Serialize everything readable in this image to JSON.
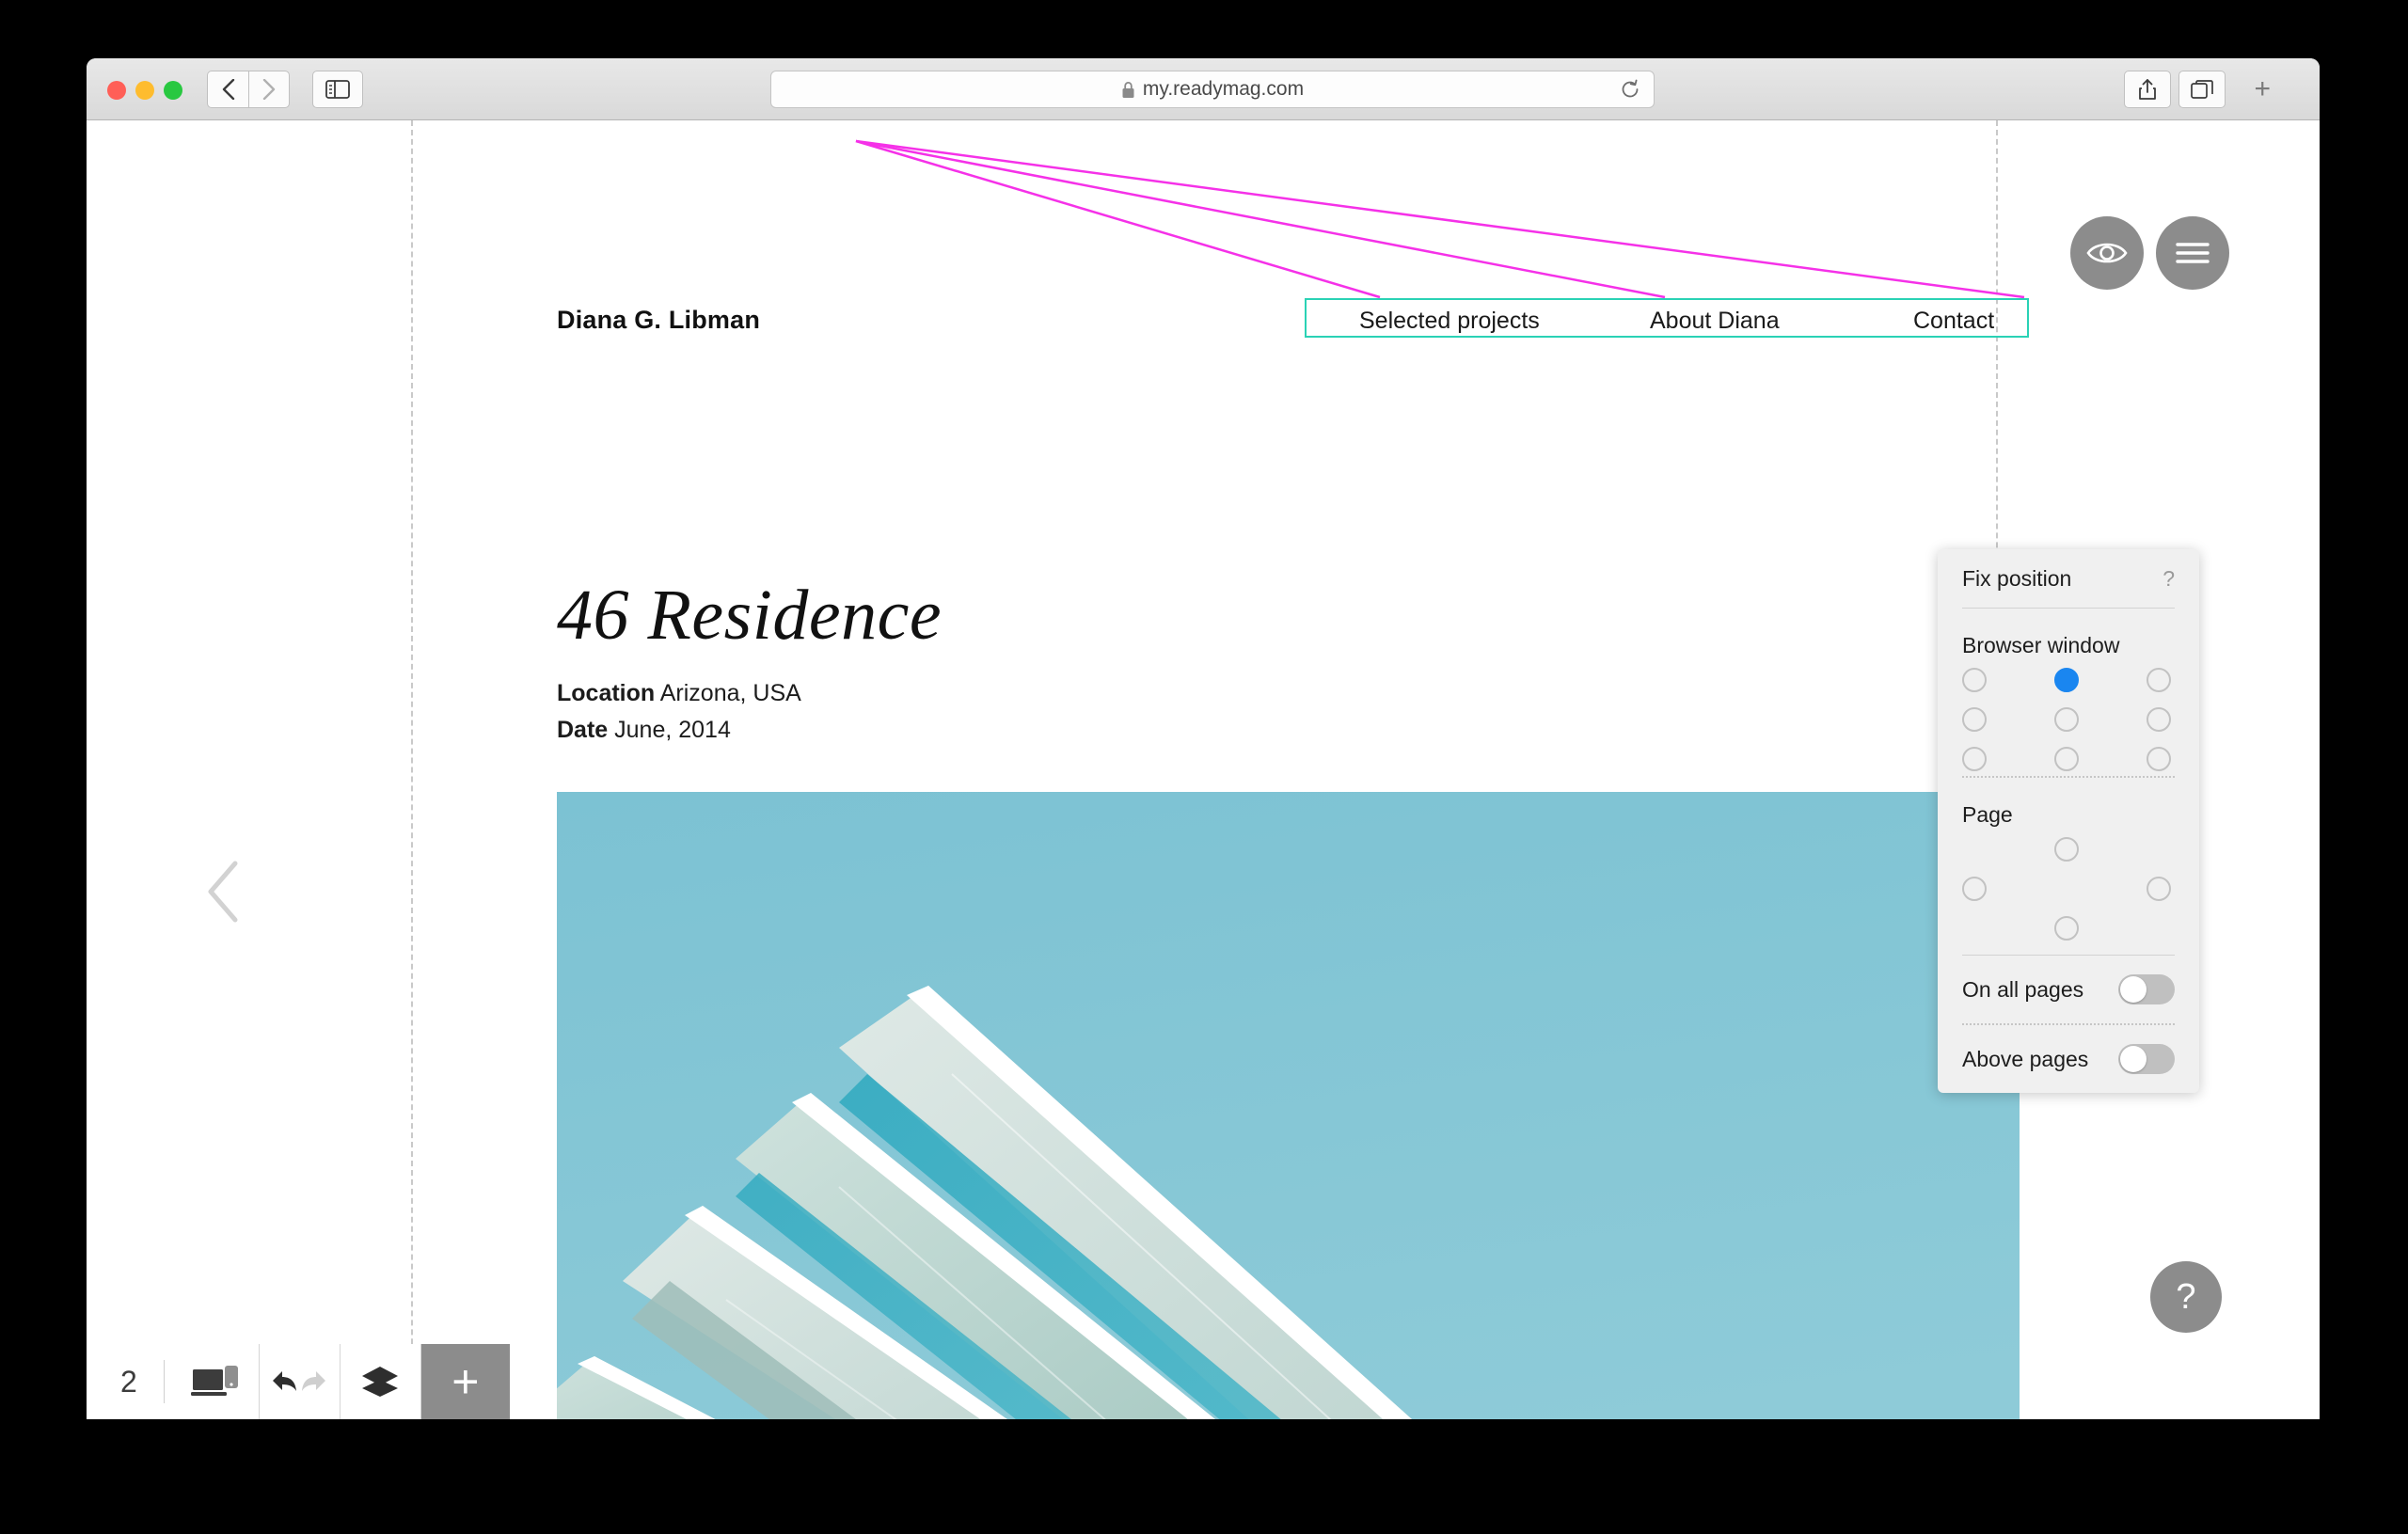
{
  "browser": {
    "url": "my.readymag.com",
    "lock_icon": "lock-icon",
    "reload_icon": "reload-icon",
    "back_icon": "chevron-left-icon",
    "forward_icon": "chevron-right-icon",
    "sidebar_icon": "sidebar-toggle-icon",
    "share_icon": "share-icon",
    "tabs_icon": "tab-overview-icon",
    "new_tab_label": "+"
  },
  "site": {
    "title": "Diana G. Libman",
    "nav": [
      {
        "label": "Selected projects"
      },
      {
        "label": "About Diana"
      },
      {
        "label": "Contact"
      }
    ],
    "project": {
      "heading": "46 Residence",
      "location_key": "Location",
      "location_value": " Arizona, USA",
      "date_key": "Date",
      "date_value": " June, 2014"
    }
  },
  "editor": {
    "preview_icon": "eye-icon",
    "menu_icon": "hamburger-menu-icon",
    "help_label": "?",
    "prev_page_icon": "chevron-left-icon",
    "next_page_icon": "chevron-right-icon",
    "selection_color": "#2ad2b5",
    "guide_color": "#ff2fe0",
    "tools": [
      {
        "name": "transform-tool",
        "icon": "resize-frame-icon",
        "active": false
      },
      {
        "name": "opacity-tool",
        "icon": "blend-circles-icon",
        "active": false
      },
      {
        "name": "align-tool",
        "icon": "align-icon",
        "active": false
      },
      {
        "name": "pin-tool",
        "icon": "pin-icon",
        "active": true
      },
      {
        "name": "layers-tool",
        "icon": "layers-icon",
        "active": false
      },
      {
        "name": "lock-tool",
        "icon": "lock-icon",
        "active": false
      }
    ],
    "bottom_bar": {
      "page_count": "2",
      "device_icon": "desktop-mobile-icon",
      "undo_icon": "undo-arrow-icon",
      "redo_icon": "redo-arrow-icon",
      "layers_icon": "layers-stack-icon",
      "add_label": "+"
    }
  },
  "fix_position_panel": {
    "title": "Fix position",
    "help_label": "?",
    "browser_section_label": "Browser window",
    "browser_anchors": [
      {
        "id": "top-left",
        "selected": false
      },
      {
        "id": "top-center",
        "selected": true
      },
      {
        "id": "top-right",
        "selected": false
      },
      {
        "id": "middle-left",
        "selected": false
      },
      {
        "id": "middle-center",
        "selected": false
      },
      {
        "id": "middle-right",
        "selected": false
      },
      {
        "id": "bottom-left",
        "selected": false
      },
      {
        "id": "bottom-center",
        "selected": false
      },
      {
        "id": "bottom-right",
        "selected": false
      }
    ],
    "page_section_label": "Page",
    "page_anchors": [
      {
        "id": "top",
        "selected": false
      },
      {
        "id": "left",
        "selected": false
      },
      {
        "id": "right",
        "selected": false
      },
      {
        "id": "bottom",
        "selected": false
      }
    ],
    "toggles": [
      {
        "label": "On all pages",
        "on": false
      },
      {
        "label": "Above pages",
        "on": false
      }
    ],
    "accent_color": "#1a86f0"
  }
}
